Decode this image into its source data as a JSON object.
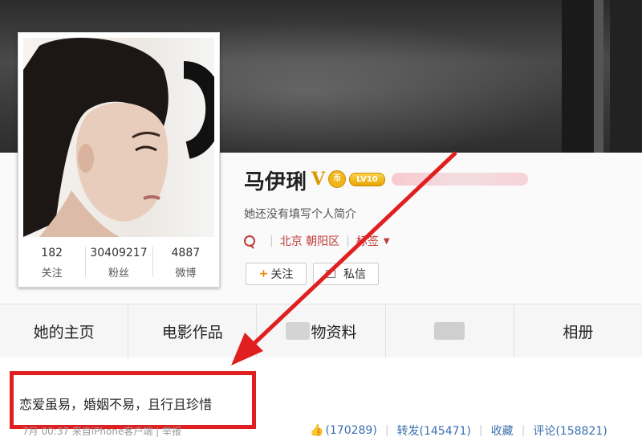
{
  "profile": {
    "name": "马伊琍",
    "verified_badge": "V",
    "coin_badge": "币",
    "level_badge": "LV10",
    "bio": "她还没有填写个人简介",
    "location": "北京 朝阳区",
    "tags_label": "标签",
    "stats": [
      {
        "value": "182",
        "label": "关注"
      },
      {
        "value": "30409217",
        "label": "粉丝"
      },
      {
        "value": "4887",
        "label": "微博"
      }
    ],
    "follow_label": "关注",
    "message_label": "私信"
  },
  "tabs": [
    {
      "label": "她的主页"
    },
    {
      "label": "电影作品"
    },
    {
      "label": "物资料"
    },
    {
      "label": ""
    },
    {
      "label": "相册"
    }
  ],
  "post": {
    "text": "恋爱虽易，婚姻不易，且行且珍惜",
    "meta": "7月 00:37 来自iPhone客户端 | 举报",
    "likes": "(170289)",
    "repost": "转发(145471)",
    "favorite": "收藏",
    "comment": "评论(158821)"
  },
  "colors": {
    "accent_red": "#e02020",
    "link_blue": "#3a6fae",
    "location_red": "#c03a3a",
    "gold": "#d99a00"
  }
}
